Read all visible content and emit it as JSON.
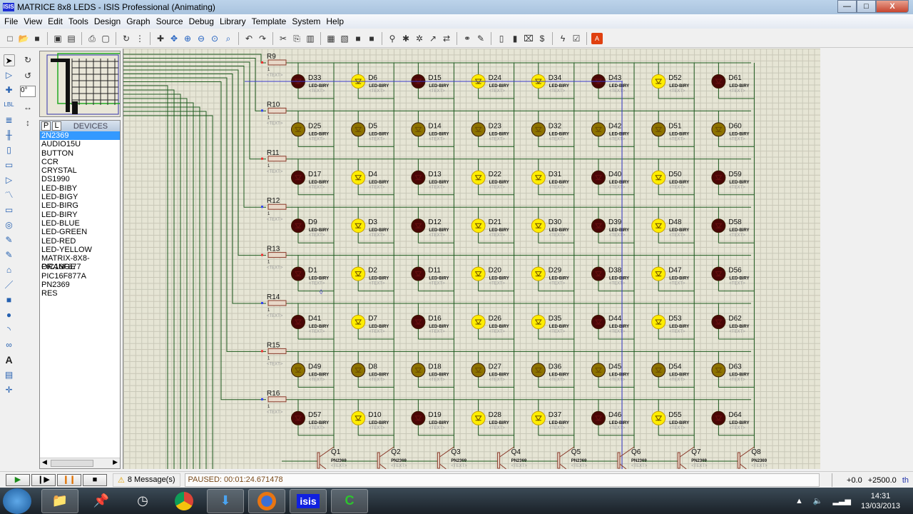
{
  "window": {
    "title": "MATRICE 8x8 LEDS - ISIS Professional (Animating)",
    "app_icon": "isis-logo",
    "controls": [
      "minimize",
      "maximize",
      "close"
    ]
  },
  "menu": [
    "File",
    "View",
    "Edit",
    "Tools",
    "Design",
    "Graph",
    "Source",
    "Debug",
    "Library",
    "Template",
    "System",
    "Help"
  ],
  "toolbar": {
    "icons": [
      "new-file-icon",
      "open-folder-icon",
      "save-icon",
      "import-icon",
      "export-icon",
      "print-icon",
      "print-area-icon",
      "refresh-icon",
      "grid-icon",
      "origin-icon",
      "pan-icon",
      "zoom-in-icon",
      "zoom-out-icon",
      "zoom-all-icon",
      "zoom-area-icon",
      "undo-icon",
      "redo-icon",
      "cut-icon",
      "copy-icon",
      "paste-icon",
      "block-copy-icon",
      "block-move-icon",
      "block-rotate-icon",
      "block-delete-icon",
      "pick-device-icon",
      "make-device-icon",
      "packaging-icon",
      "decompose-icon",
      "wire-autorouter-icon",
      "search-icon",
      "property-tool-icon",
      "new-sheet-icon",
      "remove-sheet-icon",
      "exit-parent-icon",
      "netlist-icon",
      "bom-icon",
      "erc-icon",
      "ares-icon"
    ]
  },
  "rotation": {
    "value": "0°"
  },
  "devices": {
    "tabs": [
      "P",
      "L"
    ],
    "header": "DEVICES",
    "items": [
      "2N2369",
      "AUDIO15U",
      "BUTTON",
      "CCR",
      "CRYSTAL",
      "DS1990",
      "LED-BIBY",
      "LED-BIGY",
      "LED-BIRG",
      "LED-BIRY",
      "LED-BLUE",
      "LED-GREEN",
      "LED-RED",
      "LED-YELLOW",
      "MATRIX-8X8-ORANGE",
      "PIC16F877",
      "PIC16F877A",
      "PN2369",
      "RES"
    ],
    "selected": "2N2369"
  },
  "schematic": {
    "led_type": "LED-BIRY",
    "text_placeholder": "<TEXT>",
    "colors": {
      "on": "#ffee00",
      "dim": "#8c7200",
      "off": "#4a0606",
      "wire": "#1e5a1e",
      "probe": "#3a3acc"
    },
    "resistors": [
      {
        "name": "R9",
        "value": "1"
      },
      {
        "name": "R10",
        "value": "1"
      },
      {
        "name": "R11",
        "value": "1"
      },
      {
        "name": "R12",
        "value": "1"
      },
      {
        "name": "R13",
        "value": "1"
      },
      {
        "name": "R14",
        "value": "1"
      },
      {
        "name": "R15",
        "value": "1"
      },
      {
        "name": "R16",
        "value": "1"
      }
    ],
    "led_rows": [
      {
        "names": [
          "D33",
          "D6",
          "D15",
          "D24",
          "D34",
          "D43",
          "D52",
          "D61"
        ],
        "states": [
          "off",
          "on",
          "off",
          "on",
          "on",
          "off",
          "on",
          "off"
        ]
      },
      {
        "names": [
          "D25",
          "D5",
          "D14",
          "D23",
          "D32",
          "D42",
          "D51",
          "D60"
        ],
        "states": [
          "dim",
          "dim",
          "dim",
          "dim",
          "dim",
          "dim",
          "dim",
          "dim"
        ]
      },
      {
        "names": [
          "D17",
          "D4",
          "D13",
          "D22",
          "D31",
          "D40",
          "D50",
          "D59"
        ],
        "states": [
          "off",
          "on",
          "off",
          "on",
          "on",
          "off",
          "on",
          "off"
        ]
      },
      {
        "names": [
          "D9",
          "D3",
          "D12",
          "D21",
          "D30",
          "D39",
          "D48",
          "D58"
        ],
        "states": [
          "off",
          "on",
          "off",
          "on",
          "on",
          "off",
          "on",
          "off"
        ]
      },
      {
        "names": [
          "D1",
          "D2",
          "D11",
          "D20",
          "D29",
          "D38",
          "D47",
          "D56"
        ],
        "states": [
          "off",
          "on",
          "off",
          "on",
          "on",
          "off",
          "on",
          "off"
        ]
      },
      {
        "names": [
          "D41",
          "D7",
          "D16",
          "D26",
          "D35",
          "D44",
          "D53",
          "D62"
        ],
        "states": [
          "off",
          "on",
          "off",
          "on",
          "on",
          "off",
          "on",
          "off"
        ]
      },
      {
        "names": [
          "D49",
          "D8",
          "D18",
          "D27",
          "D36",
          "D45",
          "D54",
          "D63"
        ],
        "states": [
          "dim",
          "dim",
          "dim",
          "dim",
          "dim",
          "dim",
          "dim",
          "dim"
        ]
      },
      {
        "names": [
          "D57",
          "D10",
          "D19",
          "D28",
          "D37",
          "D46",
          "D55",
          "D64"
        ],
        "states": [
          "off",
          "on",
          "off",
          "on",
          "on",
          "off",
          "on",
          "off"
        ]
      }
    ],
    "transistors": [
      {
        "name": "Q1",
        "type": "PN2369"
      },
      {
        "name": "Q2",
        "type": "PN2369"
      },
      {
        "name": "Q3",
        "type": "PN2369"
      },
      {
        "name": "Q4",
        "type": "PN2369"
      },
      {
        "name": "Q5",
        "type": "PN2369"
      },
      {
        "name": "Q6",
        "type": "PN2369"
      },
      {
        "name": "Q7",
        "type": "PN2369"
      },
      {
        "name": "Q8",
        "type": "PN2369"
      }
    ]
  },
  "status": {
    "sim_buttons": [
      "play",
      "step",
      "pause",
      "stop"
    ],
    "messages": "8 Message(s)",
    "sim_status": "PAUSED: 00:01:24.671478",
    "coord_x": "+0.0",
    "coord_y": "+2500.0",
    "units": "th"
  },
  "taskbar": {
    "apps": [
      "explorer",
      "pin",
      "clock",
      "chrome",
      "download",
      "firefox",
      "isis",
      "compiler"
    ],
    "active": "isis",
    "time": "14:31",
    "date": "13/03/2013"
  }
}
